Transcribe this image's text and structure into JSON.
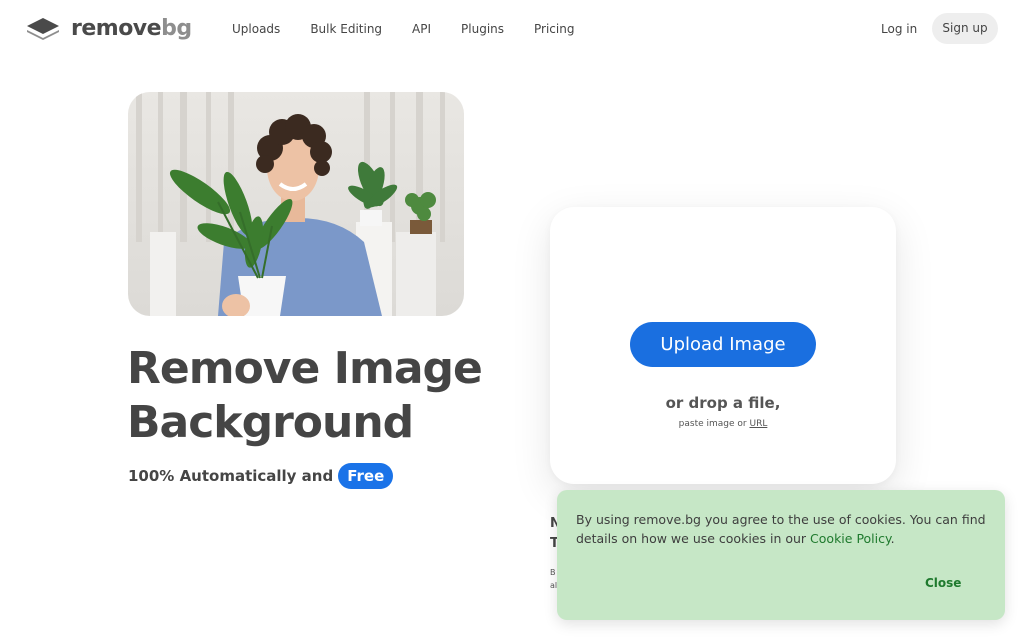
{
  "header": {
    "logo": {
      "word1": "remove",
      "word2": "bg"
    },
    "nav": [
      "Uploads",
      "Bulk Editing",
      "API",
      "Plugins",
      "Pricing"
    ],
    "login_label": "Log in",
    "signup_label": "Sign up"
  },
  "hero": {
    "headline_line1": "Remove Image",
    "headline_line2": "Background",
    "sub_text": "100% Automatically and",
    "free_badge": "Free"
  },
  "upload": {
    "button_label": "Upload Image",
    "drop_text": "or drop a file,",
    "paste_prefix": "paste image or",
    "url_link": "URL"
  },
  "behind_banner": {
    "line1": "N",
    "line2": "T",
    "small1": "B",
    "small2": "al"
  },
  "cookie": {
    "text_before_link": "By using remove.bg you agree to the use of cookies. You can find details on how we use cookies in our",
    "link_label": "Cookie Policy",
    "text_after_link": ".",
    "close_label": "Close"
  },
  "colors": {
    "accent_blue": "#1a6fe0",
    "cookie_bg": "#c6e7c6",
    "cookie_link": "#1f7a2e",
    "text_dark": "#454545"
  },
  "icons": {
    "logo": "layers-logo-icon"
  }
}
